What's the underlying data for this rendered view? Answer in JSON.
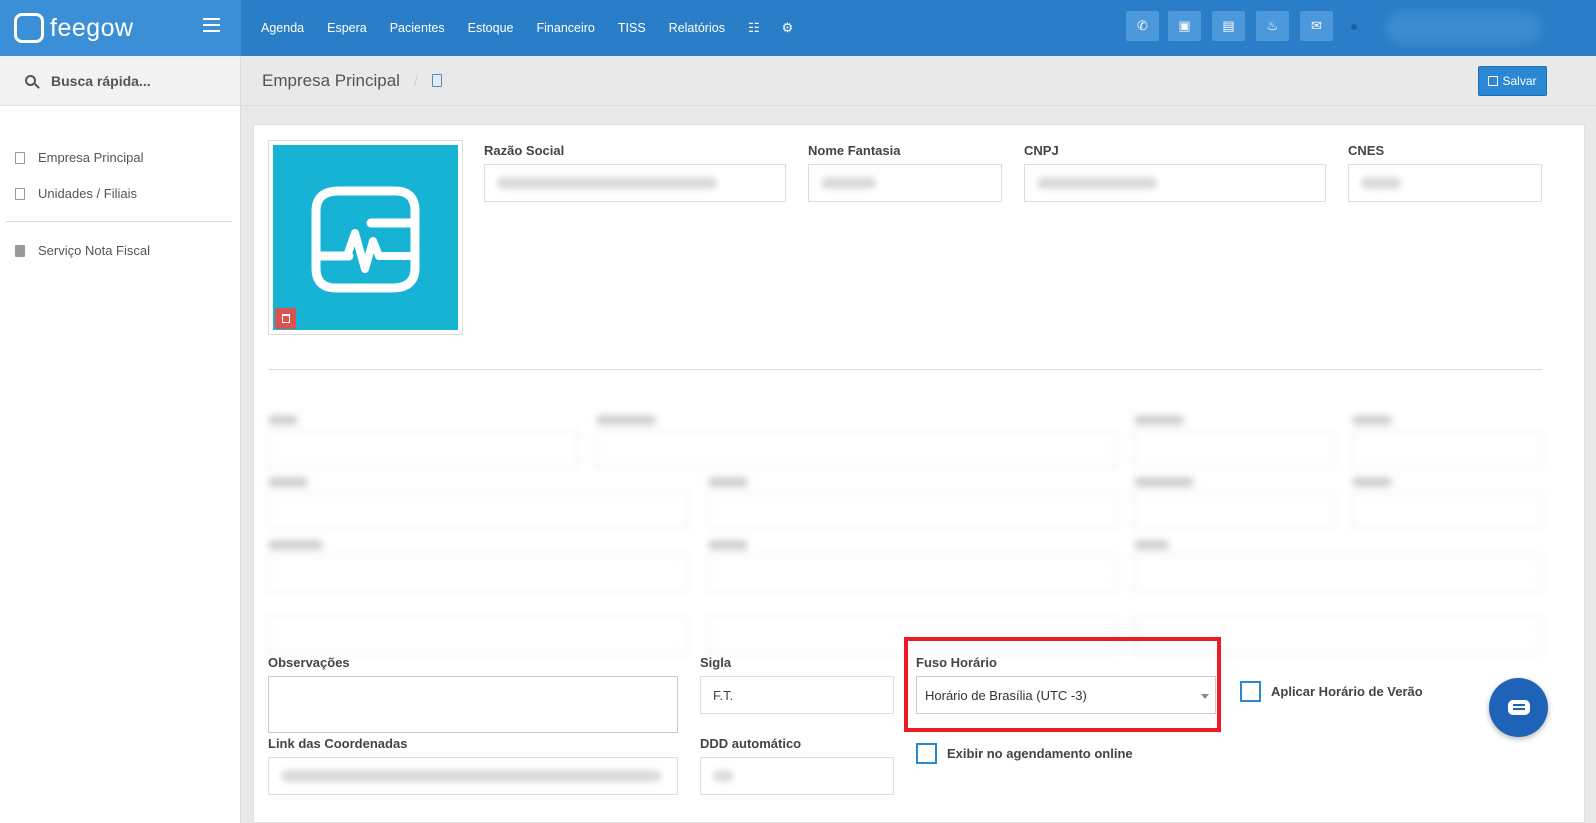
{
  "app": {
    "brand": "feegow"
  },
  "nav": {
    "items": [
      "Agenda",
      "Espera",
      "Pacientes",
      "Estoque",
      "Financeiro",
      "TISS",
      "Relatórios"
    ],
    "icons": [
      "database-icon",
      "gear-icon"
    ]
  },
  "toolbar_icons": [
    "phone-icon",
    "inbox-icon",
    "card-icon",
    "bell-icon",
    "chat-icon"
  ],
  "sidebar": {
    "search_label": "Busca rápida...",
    "items": [
      {
        "label": "Empresa Principal",
        "icon": "clipboard-icon"
      },
      {
        "label": "Unidades / Filiais",
        "icon": "clipboard-icon"
      },
      {
        "label": "Serviço Nota Fiscal",
        "icon": "document-icon"
      }
    ]
  },
  "header": {
    "title": "Empresa Principal",
    "separator": "/",
    "save_label": "Salvar"
  },
  "form": {
    "razao_social": {
      "label": "Razão Social"
    },
    "nome_fantasia": {
      "label": "Nome Fantasia"
    },
    "cnpj": {
      "label": "CNPJ"
    },
    "cnes": {
      "label": "CNES"
    },
    "observacoes": {
      "label": "Observações"
    },
    "sigla": {
      "label": "Sigla",
      "value": "F.T."
    },
    "fuso_horario": {
      "label": "Fuso Horário",
      "value": "Horário de Brasília (UTC -3)"
    },
    "horario_verao": {
      "label": "Aplicar Horário de Verão",
      "checked": false
    },
    "link_coordenadas": {
      "label": "Link das Coordenadas"
    },
    "ddd_automatico": {
      "label": "DDD automático"
    },
    "agendamento_online": {
      "label": "Exibir no agendamento online",
      "checked": false
    }
  },
  "colors": {
    "topbar": "#2a7ec7",
    "accent": "#2a87d3",
    "highlight": "#ee1b24",
    "logo_bg": "#17b3d4"
  }
}
